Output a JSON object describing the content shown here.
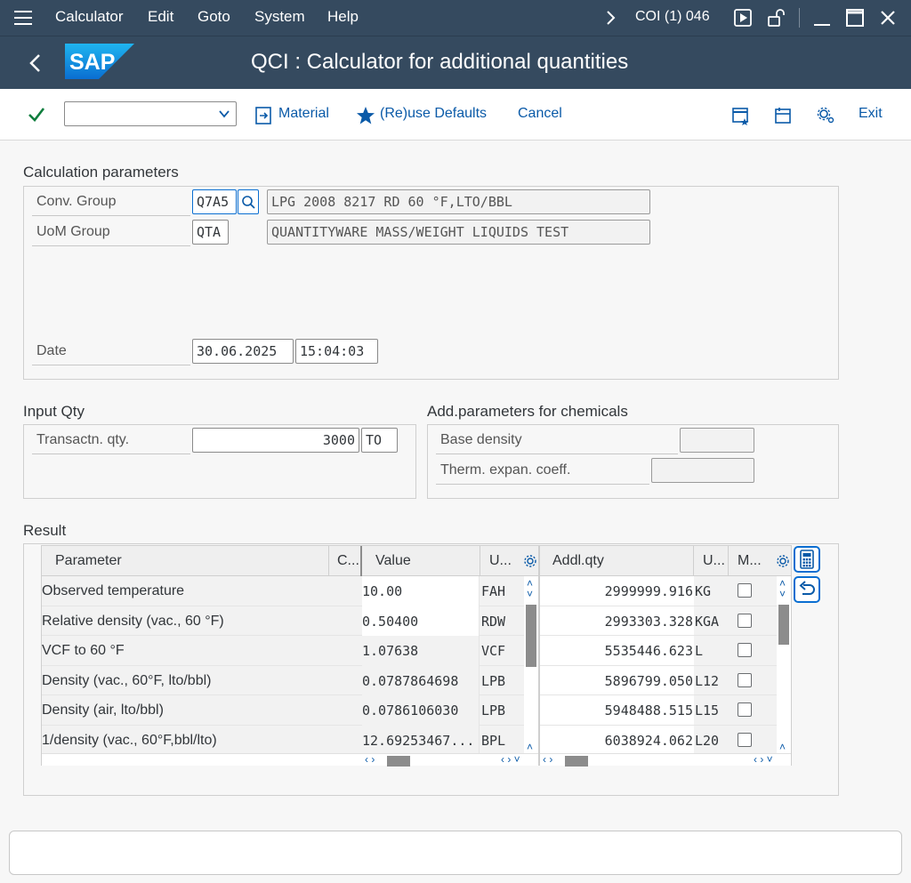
{
  "menu": {
    "items": [
      "Calculator",
      "Edit",
      "Goto",
      "System",
      "Help"
    ],
    "system_info": "COI (1) 046"
  },
  "title": "QCI : Calculator for additional quantities",
  "toolbar": {
    "material": "Material",
    "reuse_defaults": "(Re)use Defaults",
    "cancel": "Cancel",
    "exit": "Exit"
  },
  "calc_params": {
    "title": "Calculation parameters",
    "conv_group_label": "Conv. Group",
    "conv_group_value": "Q7A5",
    "conv_group_desc": "LPG 2008 8217 RD 60 °F,LTO/BBL",
    "uom_group_label": "UoM Group",
    "uom_group_value": "QTA",
    "uom_group_desc": "QUANTITYWARE MASS/WEIGHT LIQUIDS TEST",
    "date_label": "Date",
    "date_value": "30.06.2025",
    "time_value": "15:04:03"
  },
  "input_qty": {
    "title": "Input Qty",
    "label": "Transactn. qty.",
    "value": "3000",
    "unit": "TO"
  },
  "chem": {
    "title": "Add.parameters for chemicals",
    "base_density_label": "Base density",
    "therm_label": "Therm. expan. coeff."
  },
  "result": {
    "title": "Result",
    "left_headers": {
      "parameter": "Parameter",
      "c": "C...",
      "value": "Value",
      "unit": "U..."
    },
    "right_headers": {
      "addl_qty": "Addl.qty",
      "unit": "U...",
      "m": "M..."
    },
    "rows": [
      {
        "param": "Observed temperature",
        "value": "10.00",
        "unit": "FAH"
      },
      {
        "param": "Relative density (vac., 60 °F)",
        "value": "0.50400",
        "unit": "RDW"
      },
      {
        "param": "VCF to 60 °F",
        "value": "1.07638",
        "unit": "VCF"
      },
      {
        "param": "Density (vac., 60°F, lto/bbl)",
        "value": "0.0787864698",
        "unit": "LPB"
      },
      {
        "param": "Density (air, lto/bbl)",
        "value": "0.0786106030",
        "unit": "LPB"
      },
      {
        "param": "1/density (vac., 60°F,bbl/lto)",
        "value": "12.69253467...",
        "unit": "BPL"
      }
    ],
    "addl": [
      {
        "qty": "2999999.916",
        "unit": "KG"
      },
      {
        "qty": "2993303.328",
        "unit": "KGA"
      },
      {
        "qty": "5535446.623",
        "unit": "L"
      },
      {
        "qty": "5896799.050",
        "unit": "L12"
      },
      {
        "qty": "5948488.515",
        "unit": "L15"
      },
      {
        "qty": "6038924.062",
        "unit": "L20"
      }
    ]
  },
  "colors": {
    "shell": "#354a5f",
    "accent": "#0a6ed1",
    "link": "#0a5aa8",
    "check": "#107e3e"
  },
  "icons": [
    "menu-icon",
    "back-icon",
    "check-icon",
    "dropdown-chevron-icon",
    "material-icon",
    "star-icon",
    "layout-icon",
    "settings-icon",
    "calculator-icon",
    "undo-icon"
  ]
}
